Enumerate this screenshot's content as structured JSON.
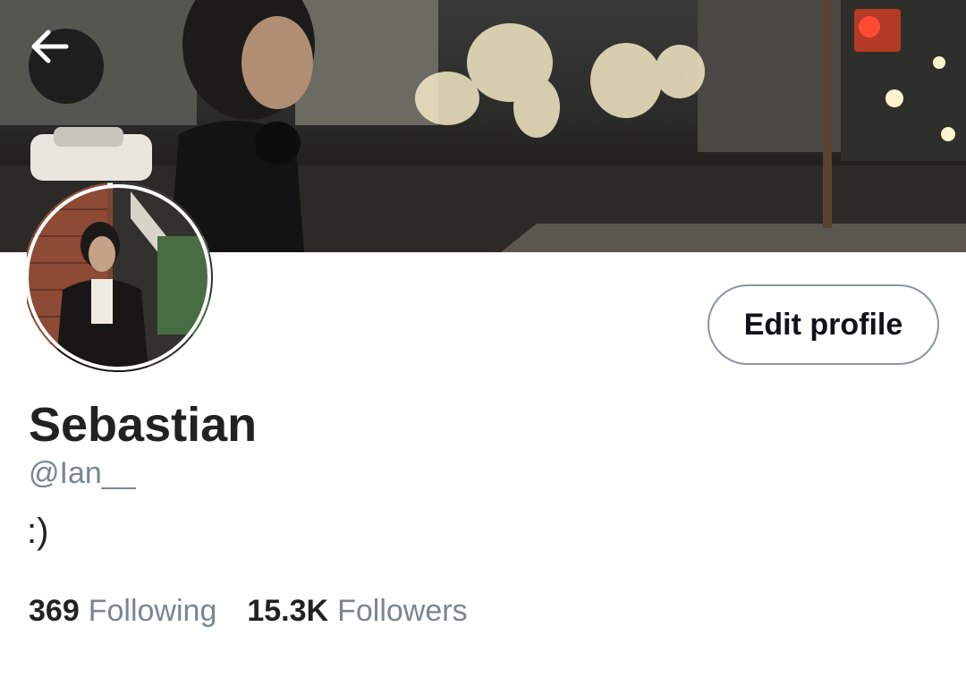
{
  "header": {
    "back_icon": "arrow-left-icon"
  },
  "profile": {
    "display_name": "Sebastian",
    "handle": "@Ian__",
    "bio": ":)",
    "edit_label": "Edit profile"
  },
  "stats": {
    "following_count": "369",
    "following_label": "Following",
    "followers_count": "15.3K",
    "followers_label": "Followers"
  },
  "colors": {
    "text_primary": "#222222",
    "text_secondary": "#7a868f",
    "button_border": "#8a959e"
  }
}
